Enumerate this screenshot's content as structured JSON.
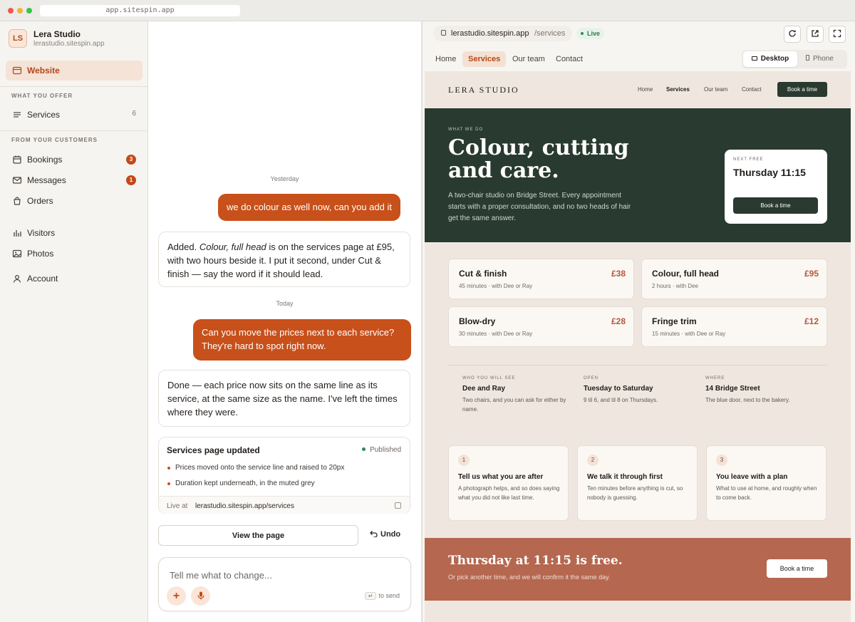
{
  "browser": {
    "url": "app.sitespin.app"
  },
  "sidebar": {
    "logo_initials": "LS",
    "studio_name": "Lera Studio",
    "studio_url": "lerastudio.sitespin.app",
    "website_label": "Website",
    "section_offer": "WHAT YOU OFFER",
    "services_label": "Services",
    "services_count": "6",
    "section_customers": "FROM YOUR CUSTOMERS",
    "bookings_label": "Bookings",
    "bookings_badge": "3",
    "messages_label": "Messages",
    "messages_badge": "1",
    "orders_label": "Orders",
    "visitors_label": "Visitors",
    "photos_label": "Photos",
    "account_label": "Account"
  },
  "chat": {
    "day1": "Yesterday",
    "user_msg1": "we do colour as well now, can you add it",
    "assistant_msg1_a": "Added. ",
    "assistant_msg1_em": "Colour, full head",
    "assistant_msg1_b": " is on the services page at £95, with two hours beside it. I put it second, under Cut & finish — say the word if it should lead.",
    "day2": "Today",
    "user_msg2": "Can you move the prices next to each service? They're hard to spot right now.",
    "assistant_msg2": "Done — each price now sits on the same line as its service, at the same size as the name. I've left the times where they were.",
    "card": {
      "title": "Services page updated",
      "status": "Published",
      "bullet1": "Prices moved onto the service line and raised to 20px",
      "bullet2": "Duration kept underneath, in the muted grey",
      "live_label": "Live at",
      "live_url": "lerastudio.sitespin.app/services"
    },
    "view_button": "View the page",
    "undo_button": "Undo",
    "composer_placeholder": "Tell me what to change...",
    "send_key": "↵",
    "send_hint": "to send"
  },
  "preview": {
    "host": "lerastudio.sitespin.app",
    "path": "/services",
    "live_badge": "Live",
    "tabs": [
      "Home",
      "Services",
      "Our team",
      "Contact"
    ],
    "desktop_label": "Desktop",
    "phone_label": "Phone"
  },
  "site": {
    "logo": "LERA STUDIO",
    "nav": [
      "Home",
      "Services",
      "Our team",
      "Contact"
    ],
    "book_label": "Book a time",
    "hero_eyebrow": "WHAT WE DO",
    "hero_title": "Colour, cutting and care.",
    "hero_sub": "A two-chair studio on Bridge Street. Every appointment starts with a proper consultation, and no two heads of hair get the same answer.",
    "next_label": "NEXT FREE",
    "next_time": "Thursday 11:15",
    "next_button": "Book a time",
    "services": [
      {
        "name": "Cut & finish",
        "price": "£38",
        "detail": "45 minutes · with Dee or Ray"
      },
      {
        "name": "Colour, full head",
        "price": "£95",
        "detail": "2 hours · with Dee"
      },
      {
        "name": "Blow-dry",
        "price": "£28",
        "detail": "30 minutes · with Dee or Ray"
      },
      {
        "name": "Fringe trim",
        "price": "£12",
        "detail": "15 minutes · with Dee or Ray"
      }
    ],
    "info": [
      {
        "label": "WHO YOU WILL SEE",
        "title": "Dee and Ray",
        "desc": "Two chairs, and you can ask for either by name."
      },
      {
        "label": "OPEN",
        "title": "Tuesday to Saturday",
        "desc": "9 til 6, and til 8 on Thursdays."
      },
      {
        "label": "WHERE",
        "title": "14 Bridge Street",
        "desc": "The blue door, next to the bakery."
      }
    ],
    "steps": [
      {
        "num": "1",
        "title": "Tell us what you are after",
        "desc": "A photograph helps, and so does saying what you did not like last time."
      },
      {
        "num": "2",
        "title": "We talk it through first",
        "desc": "Ten minutes before anything is cut, so nobody is guessing."
      },
      {
        "num": "3",
        "title": "You leave with a plan",
        "desc": "What to use at home, and roughly when to come back."
      }
    ],
    "cta_title": "Thursday at 11:15 is free.",
    "cta_sub": "Or pick another time, and we will confirm it the same day.",
    "cta_button": "Book a time"
  }
}
